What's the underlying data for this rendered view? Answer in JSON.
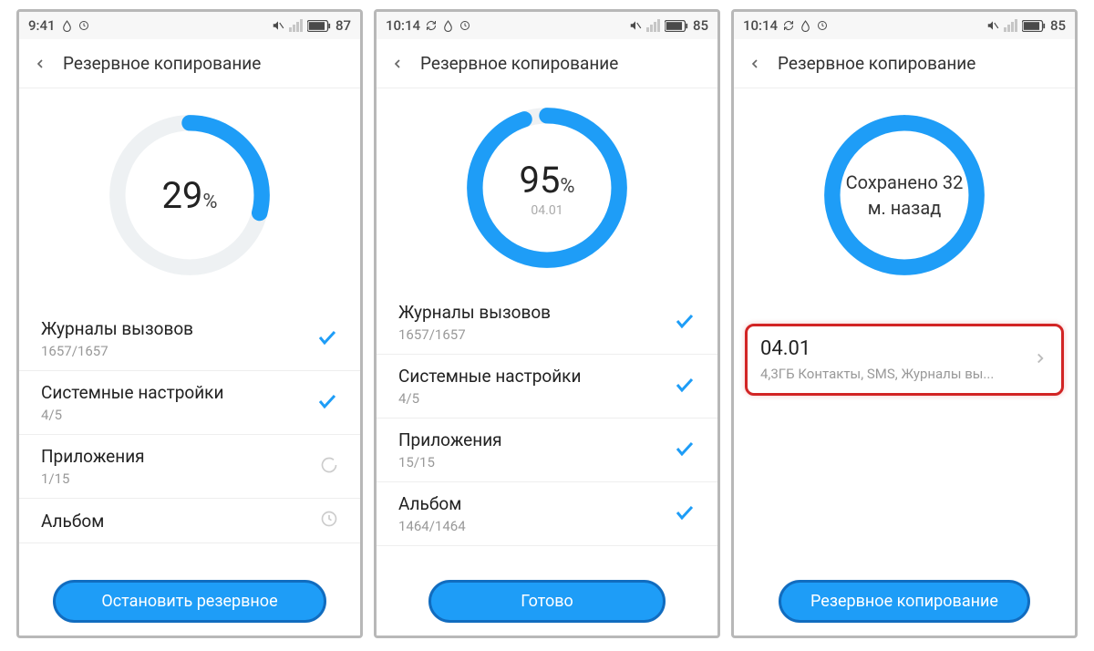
{
  "screens": [
    {
      "status": {
        "time": "9:41",
        "battery": "87"
      },
      "header": {
        "title": "Резервное копирование"
      },
      "progress": {
        "percent": 29,
        "sub": ""
      },
      "items": [
        {
          "title": "Журналы вызовов",
          "sub": "1657/1657",
          "state": "done"
        },
        {
          "title": "Системные настройки",
          "sub": "4/5",
          "state": "done"
        },
        {
          "title": "Приложения",
          "sub": "1/15",
          "state": "loading"
        },
        {
          "title": "Альбом",
          "sub": "",
          "state": "pending"
        }
      ],
      "button": "Остановить резервное"
    },
    {
      "status": {
        "time": "10:14",
        "battery": "85"
      },
      "header": {
        "title": "Резервное копирование"
      },
      "progress": {
        "percent": 95,
        "sub": "04.01"
      },
      "items": [
        {
          "title": "Журналы вызовов",
          "sub": "1657/1657",
          "state": "done"
        },
        {
          "title": "Системные настройки",
          "sub": "4/5",
          "state": "done"
        },
        {
          "title": "Приложения",
          "sub": "15/15",
          "state": "done"
        },
        {
          "title": "Альбом",
          "sub": "1464/1464",
          "state": "done"
        }
      ],
      "button": "Готово"
    },
    {
      "status": {
        "time": "10:14",
        "battery": "85"
      },
      "header": {
        "title": "Резервное копирование"
      },
      "saved_text_l1": "Сохранено 32",
      "saved_text_l2": "м. назад",
      "backup": {
        "title": "04.01",
        "sub": "4,3ГБ  Контакты, SMS, Журналы вы..."
      },
      "button": "Резервное копирование"
    }
  ]
}
